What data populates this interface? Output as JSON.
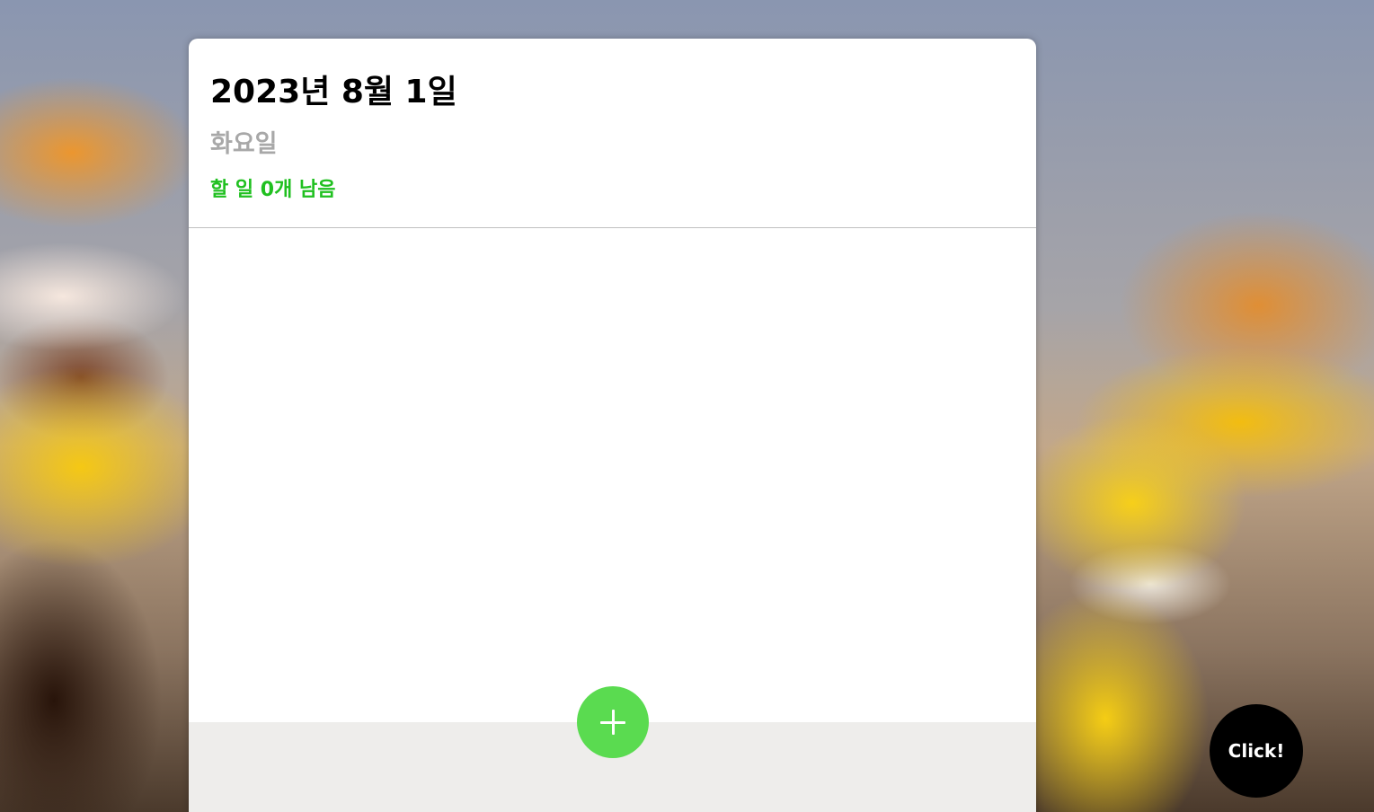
{
  "header": {
    "date": "2023년 8월 1일",
    "weekday": "화요일",
    "tasks_left": "할 일 0개 남음"
  },
  "todo_list": {
    "items": []
  },
  "add_button": {
    "icon": "plus-icon"
  },
  "click_button": {
    "label": "Click!"
  },
  "colors": {
    "accent_green": "#5adb50",
    "tasks_left_text": "#20c020",
    "weekday_text": "#a8a8a8",
    "footer_background": "#eeedeb",
    "click_button_background": "#000000"
  }
}
